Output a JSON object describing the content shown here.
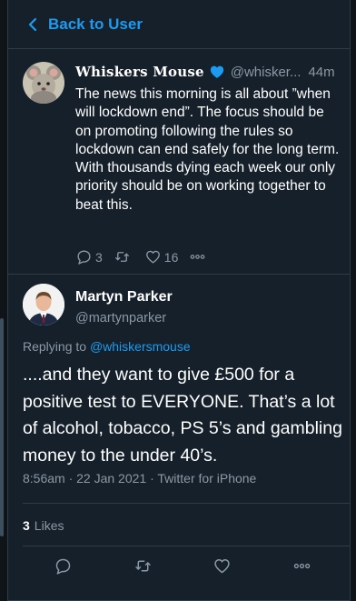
{
  "nav": {
    "back_label": "Back to User"
  },
  "quoted_tweet": {
    "display_name": "Whiskers Mouse",
    "handle": "@whisker...",
    "time": "44m",
    "text": "The news this morning is all about ”when will lockdown end”.  The focus should be on promoting following the rules so lockdown can end safely for the long term. With thousands dying each week our only priority should be on working together to beat this.",
    "reply_count": "3",
    "retweet_count": "",
    "like_count": "16",
    "icons": [
      "verified-icon",
      "reply-icon",
      "retweet-icon",
      "like-icon",
      "more-icon"
    ]
  },
  "main_tweet": {
    "display_name": "Martyn Parker",
    "handle": "@martynparker",
    "replying_prefix": "Replying to ",
    "replying_to": "@whiskersmouse",
    "text": "....and they want to give £500 for a positive test to EVERYONE. That’s a lot of alcohol, tobacco, PS 5’s and gambling money to the under 40’s.",
    "meta": "8:56am · 22 Jan 2021 · Twitter for iPhone",
    "likes_count": "3",
    "likes_label": "Likes",
    "icons": [
      "reply-icon",
      "retweet-icon",
      "like-icon",
      "more-icon"
    ]
  },
  "colors": {
    "background": "#15202b",
    "accent": "#1d9bf0",
    "secondary_text": "#8b98a5",
    "divider": "#2f3b47"
  }
}
